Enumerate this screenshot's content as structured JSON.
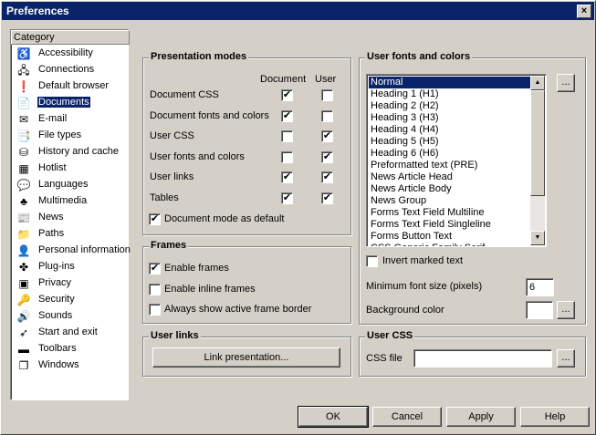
{
  "window": {
    "title": "Preferences",
    "close_label": "×"
  },
  "categories": {
    "header": "Category",
    "items": [
      {
        "label": "Accessibility",
        "icon": "accessibility-icon",
        "glyph": "♿"
      },
      {
        "label": "Connections",
        "icon": "connections-icon",
        "glyph": "🖧"
      },
      {
        "label": "Default browser",
        "icon": "default-browser-icon",
        "glyph": "❗"
      },
      {
        "label": "Documents",
        "icon": "documents-icon",
        "glyph": "📄"
      },
      {
        "label": "E-mail",
        "icon": "email-icon",
        "glyph": "✉"
      },
      {
        "label": "File types",
        "icon": "file-types-icon",
        "glyph": "📑"
      },
      {
        "label": "History and cache",
        "icon": "history-icon",
        "glyph": "⛁"
      },
      {
        "label": "Hotlist",
        "icon": "hotlist-icon",
        "glyph": "▦"
      },
      {
        "label": "Languages",
        "icon": "languages-icon",
        "glyph": "💬"
      },
      {
        "label": "Multimedia",
        "icon": "multimedia-icon",
        "glyph": "♣"
      },
      {
        "label": "News",
        "icon": "news-icon",
        "glyph": "📰"
      },
      {
        "label": "Paths",
        "icon": "paths-icon",
        "glyph": "📁"
      },
      {
        "label": "Personal information",
        "icon": "personal-info-icon",
        "glyph": "👤"
      },
      {
        "label": "Plug-ins",
        "icon": "plugins-icon",
        "glyph": "✤"
      },
      {
        "label": "Privacy",
        "icon": "privacy-icon",
        "glyph": "▣"
      },
      {
        "label": "Security",
        "icon": "security-icon",
        "glyph": "🔑"
      },
      {
        "label": "Sounds",
        "icon": "sounds-icon",
        "glyph": "🔊"
      },
      {
        "label": "Start and exit",
        "icon": "start-exit-icon",
        "glyph": "➶"
      },
      {
        "label": "Toolbars",
        "icon": "toolbars-icon",
        "glyph": "▬"
      },
      {
        "label": "Windows",
        "icon": "windows-icon",
        "glyph": "❐"
      }
    ],
    "selected": "Documents"
  },
  "presentation": {
    "title": "Presentation modes",
    "col_document": "Document",
    "col_user": "User",
    "rows": [
      {
        "label": "Document CSS",
        "document": true,
        "user": false
      },
      {
        "label": "Document fonts and colors",
        "document": true,
        "user": false
      },
      {
        "label": "User CSS",
        "document": false,
        "user": true
      },
      {
        "label": "User fonts and colors",
        "document": false,
        "user": true
      },
      {
        "label": "User links",
        "document": true,
        "user": true
      },
      {
        "label": "Tables",
        "document": true,
        "user": true
      }
    ],
    "default_mode_label": "Document mode as default",
    "default_mode_checked": true
  },
  "frames": {
    "title": "Frames",
    "options": [
      {
        "label": "Enable frames",
        "checked": true
      },
      {
        "label": "Enable inline frames",
        "checked": false
      },
      {
        "label": "Always show active frame border",
        "checked": false
      }
    ]
  },
  "user_links": {
    "title": "User links",
    "button": "Link presentation..."
  },
  "fonts_colors": {
    "title": "User fonts and colors",
    "styles": [
      "Normal",
      "Heading 1 (H1)",
      "Heading 2 (H2)",
      "Heading 3 (H3)",
      "Heading 4 (H4)",
      "Heading 5 (H5)",
      "Heading 6 (H6)",
      "Preformatted text (PRE)",
      "News Article Head",
      "News Article Body",
      "News Group",
      "Forms Text Field Multiline",
      "Forms Text Field Singleline",
      "Forms Button Text",
      "CSS Generic Family Serif"
    ],
    "selected_style": "Normal",
    "browse": "...",
    "invert_label": "Invert marked text",
    "invert_checked": false,
    "min_font_label": "Minimum font size (pixels)",
    "min_font_value": "6",
    "bg_color_label": "Background color",
    "bg_color": "#ffffff"
  },
  "user_css": {
    "title": "User CSS",
    "file_label": "CSS file",
    "file_value": "",
    "browse": "..."
  },
  "buttons": {
    "ok": "OK",
    "cancel": "Cancel",
    "apply": "Apply",
    "help": "Help"
  }
}
